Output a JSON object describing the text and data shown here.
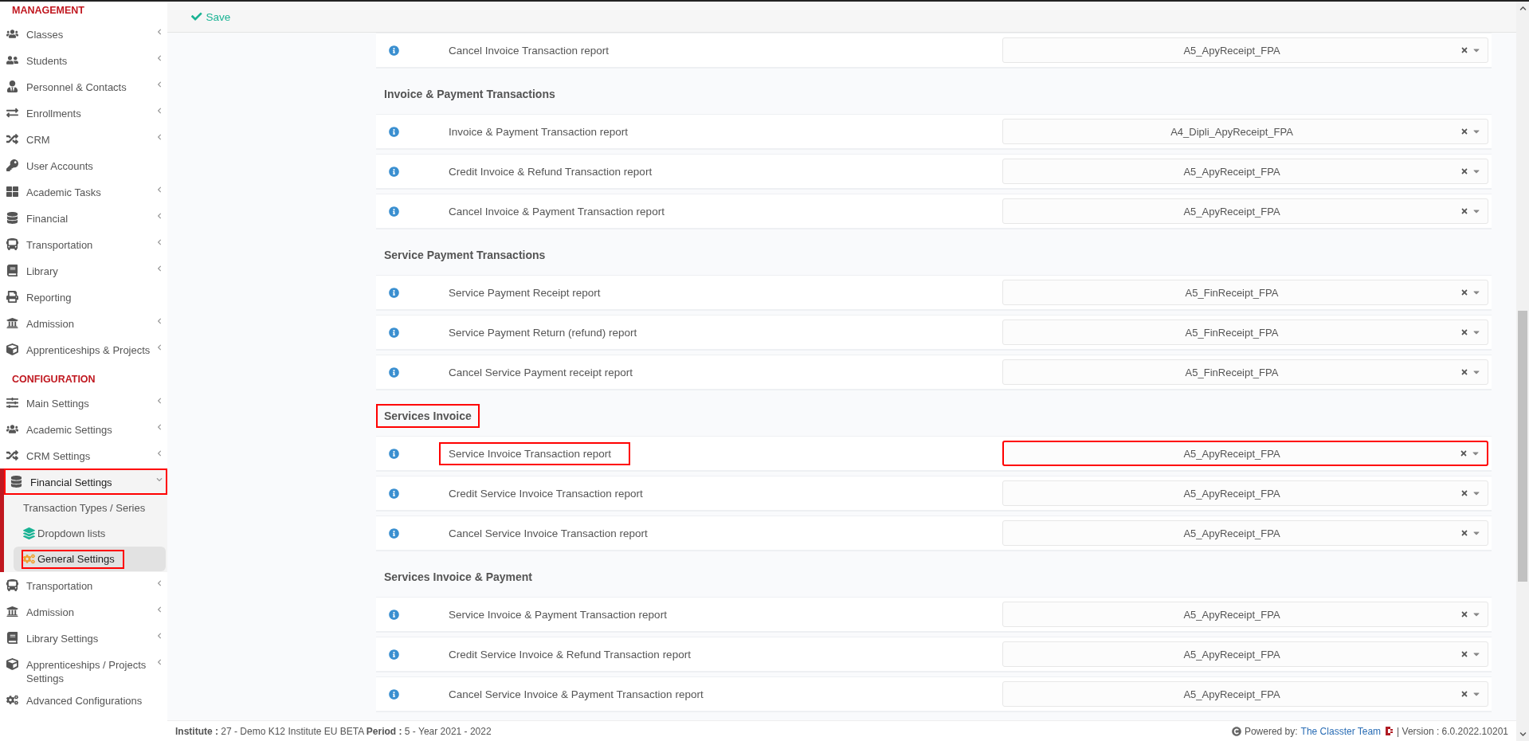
{
  "topbar": {
    "save": "Save"
  },
  "sidebar": {
    "sections": [
      {
        "title": "MANAGEMENT",
        "items": [
          {
            "label": "Classes",
            "chevron": true
          },
          {
            "label": "Students",
            "chevron": true
          },
          {
            "label": "Personnel & Contacts",
            "chevron": true
          },
          {
            "label": "Enrollments",
            "chevron": true
          },
          {
            "label": "CRM",
            "chevron": true
          },
          {
            "label": "User Accounts",
            "chevron": false
          },
          {
            "label": "Academic Tasks",
            "chevron": true
          },
          {
            "label": "Financial",
            "chevron": true
          },
          {
            "label": "Transportation",
            "chevron": true
          },
          {
            "label": "Library",
            "chevron": true
          },
          {
            "label": "Reporting",
            "chevron": false
          },
          {
            "label": "Admission",
            "chevron": true
          },
          {
            "label": "Apprenticeships & Projects",
            "chevron": true
          }
        ]
      },
      {
        "title": "CONFIGURATION",
        "items": [
          {
            "label": "Main Settings",
            "chevron": true
          },
          {
            "label": "Academic Settings",
            "chevron": true
          },
          {
            "label": "CRM Settings",
            "chevron": true
          },
          {
            "label": "Financial Settings",
            "chevron": true,
            "expanded": true,
            "highlighted": true,
            "children": [
              {
                "label": "Transaction Types / Series",
                "selected": false,
                "highlighted": false
              },
              {
                "label": "Dropdown lists",
                "selected": false,
                "highlighted": false
              },
              {
                "label": "General Settings",
                "selected": true,
                "highlighted": true
              }
            ]
          },
          {
            "label": "Transportation",
            "chevron": true
          },
          {
            "label": "Admission",
            "chevron": true
          },
          {
            "label": "Library Settings",
            "chevron": true
          },
          {
            "label": "Apprenticeships / Projects Settings",
            "chevron": true
          },
          {
            "label": "Advanced Configurations",
            "chevron": false
          }
        ]
      }
    ]
  },
  "content": {
    "sections": [
      {
        "rows": [
          {
            "label": "Cancel Invoice Transaction report",
            "value": "A5_ApyReceipt_FPA"
          }
        ]
      },
      {
        "title": "Invoice & Payment Transactions",
        "rows": [
          {
            "label": "Invoice & Payment Transaction report",
            "value": "A4_Dipli_ApyReceipt_FPA"
          },
          {
            "label": "Credit Invoice & Refund Transaction report",
            "value": "A5_ApyReceipt_FPA"
          },
          {
            "label": "Cancel Invoice & Payment Transaction report",
            "value": "A5_ApyReceipt_FPA"
          }
        ]
      },
      {
        "title": "Service Payment Transactions",
        "rows": [
          {
            "label": "Service Payment Receipt report",
            "value": "A5_FinReceipt_FPA"
          },
          {
            "label": "Service Payment Return (refund) report",
            "value": "A5_FinReceipt_FPA"
          },
          {
            "label": "Cancel Service Payment receipt report",
            "value": "A5_FinReceipt_FPA"
          }
        ]
      },
      {
        "title": "Services Invoice",
        "highlighted": true,
        "rows": [
          {
            "label": "Service Invoice Transaction report",
            "value": "A5_ApyReceipt_FPA",
            "label_highlighted": true,
            "value_highlighted": true
          },
          {
            "label": "Credit Service Invoice Transaction report",
            "value": "A5_ApyReceipt_FPA"
          },
          {
            "label": "Cancel Service Invoice Transaction report",
            "value": "A5_ApyReceipt_FPA"
          }
        ]
      },
      {
        "title": "Services Invoice & Payment",
        "rows": [
          {
            "label": "Service Invoice & Payment Transaction report",
            "value": "A5_ApyReceipt_FPA"
          },
          {
            "label": "Credit Service Invoice & Refund Transaction report",
            "value": "A5_ApyReceipt_FPA"
          },
          {
            "label": "Cancel Service Invoice & Payment Transaction report",
            "value": "A5_ApyReceipt_FPA"
          }
        ]
      }
    ]
  },
  "footer": {
    "institute": "**Institute :** 27 - Demo K12 Institute EU BETA **Period :** 5 - Year 2021 - 2022",
    "powered_by": "Powered by:",
    "team_link": "The Classter Team",
    "version": "| Version : 6.0.2022.10201"
  }
}
